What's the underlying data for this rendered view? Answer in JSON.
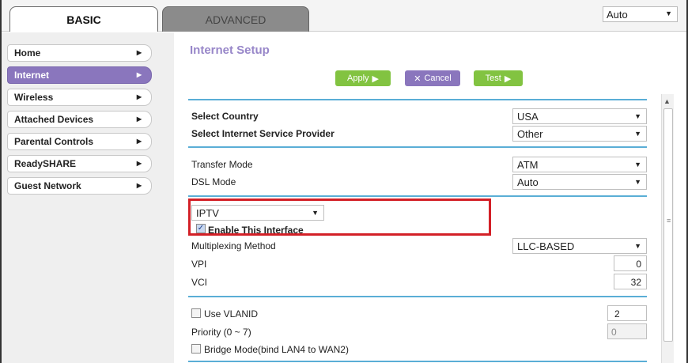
{
  "tabs": {
    "basic": "BASIC",
    "advanced": "ADVANCED"
  },
  "language": {
    "value": "Auto"
  },
  "menu": {
    "items": [
      {
        "label": "Home"
      },
      {
        "label": "Internet"
      },
      {
        "label": "Wireless"
      },
      {
        "label": "Attached Devices"
      },
      {
        "label": "Parental Controls"
      },
      {
        "label": "ReadySHARE"
      },
      {
        "label": "Guest Network"
      }
    ],
    "active": "Internet"
  },
  "page": {
    "title": "Internet Setup"
  },
  "buttons": {
    "apply": "Apply",
    "cancel": "Cancel",
    "test": "Test"
  },
  "country": {
    "label": "Select Country",
    "value": "USA"
  },
  "isp": {
    "label": "Select Internet Service Provider",
    "value": "Other"
  },
  "transfer_mode": {
    "label": "Transfer Mode",
    "value": "ATM"
  },
  "dsl_mode": {
    "label": "DSL Mode",
    "value": "Auto"
  },
  "interface": {
    "value": "IPTV",
    "enable_label": "Enable This Interface",
    "enabled": true
  },
  "multiplexing": {
    "label": "Multiplexing Method",
    "value": "LLC-BASED"
  },
  "vpi": {
    "label": "VPI",
    "value": "0"
  },
  "vci": {
    "label": "VCI",
    "value": "32"
  },
  "vlan": {
    "label": "Use VLANID",
    "value": "2",
    "checked": false
  },
  "priority": {
    "label": "Priority  (0 ~ 7)",
    "value": "0"
  },
  "bridge": {
    "label": "Bridge Mode(bind LAN4 to WAN2)",
    "checked": false
  },
  "colors": {
    "accent": "#8a76bd",
    "green": "#82c341",
    "rule": "#5aaed6",
    "highlight": "#d32027"
  }
}
